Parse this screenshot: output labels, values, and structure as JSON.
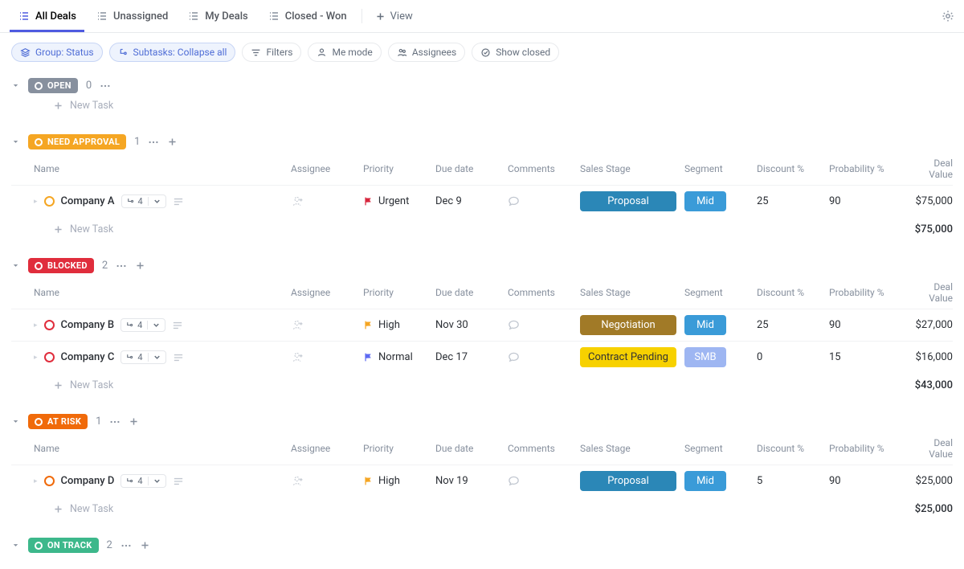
{
  "tabs": [
    {
      "label": "All Deals",
      "active": true
    },
    {
      "label": "Unassigned",
      "active": false
    },
    {
      "label": "My Deals",
      "active": false
    },
    {
      "label": "Closed - Won",
      "active": false
    }
  ],
  "add_view": "View",
  "toolbar": {
    "group": "Group: Status",
    "subtasks": "Subtasks: Collapse all",
    "filters": "Filters",
    "me": "Me mode",
    "assignees": "Assignees",
    "show_closed": "Show closed"
  },
  "columns": [
    "Name",
    "Assignee",
    "Priority",
    "Due date",
    "Comments",
    "Sales Stage",
    "Segment",
    "Discount %",
    "Probability %",
    "Deal Value"
  ],
  "new_task": "New Task",
  "priorities": {
    "urgent": "Urgent",
    "high": "High",
    "normal": "Normal"
  },
  "stages": {
    "proposal": "Proposal",
    "negotiation": "Negotiation",
    "contract_pending": "Contract Pending"
  },
  "segments": {
    "mid": "Mid",
    "smb": "SMB"
  },
  "colors": {
    "open": "#87909e",
    "need_approval": "#f5a623",
    "blocked": "#e02d3c",
    "at_risk": "#f06a0a",
    "on_track": "#3db88b",
    "proposal": "#2b87b7",
    "negotiation": "#a17a27",
    "contract_pending": "#f7d100",
    "mid": "#3a9bd8",
    "smb": "#9eb6f2",
    "flag_urgent": "#d7263d",
    "flag_high": "#f5a623",
    "flag_normal": "#5d6af2"
  },
  "groups": [
    {
      "key": "open",
      "label": "OPEN",
      "count": "0",
      "rows": [],
      "sum": null
    },
    {
      "key": "need_approval",
      "label": "NEED APPROVAL",
      "count": "1",
      "rows": [
        {
          "name": "Company A",
          "sub": "4",
          "priority": "urgent",
          "due": "Dec 9",
          "stage": "proposal",
          "seg": "mid",
          "disc": "25",
          "prob": "90",
          "val": "$75,000"
        }
      ],
      "sum": "$75,000"
    },
    {
      "key": "blocked",
      "label": "BLOCKED",
      "count": "2",
      "rows": [
        {
          "name": "Company B",
          "sub": "4",
          "priority": "high",
          "due": "Nov 30",
          "stage": "negotiation",
          "seg": "mid",
          "disc": "25",
          "prob": "90",
          "val": "$27,000"
        },
        {
          "name": "Company C",
          "sub": "4",
          "priority": "normal",
          "due": "Dec 17",
          "stage": "contract_pending",
          "seg": "smb",
          "disc": "0",
          "prob": "15",
          "val": "$16,000"
        }
      ],
      "sum": "$43,000"
    },
    {
      "key": "at_risk",
      "label": "AT RISK",
      "count": "1",
      "rows": [
        {
          "name": "Company D",
          "sub": "4",
          "priority": "high",
          "due": "Nov 19",
          "stage": "proposal",
          "seg": "mid",
          "disc": "5",
          "prob": "90",
          "val": "$25,000"
        }
      ],
      "sum": "$25,000"
    },
    {
      "key": "on_track",
      "label": "ON TRACK",
      "count": "2",
      "rows": [],
      "sum": null,
      "collapsed": true
    }
  ]
}
